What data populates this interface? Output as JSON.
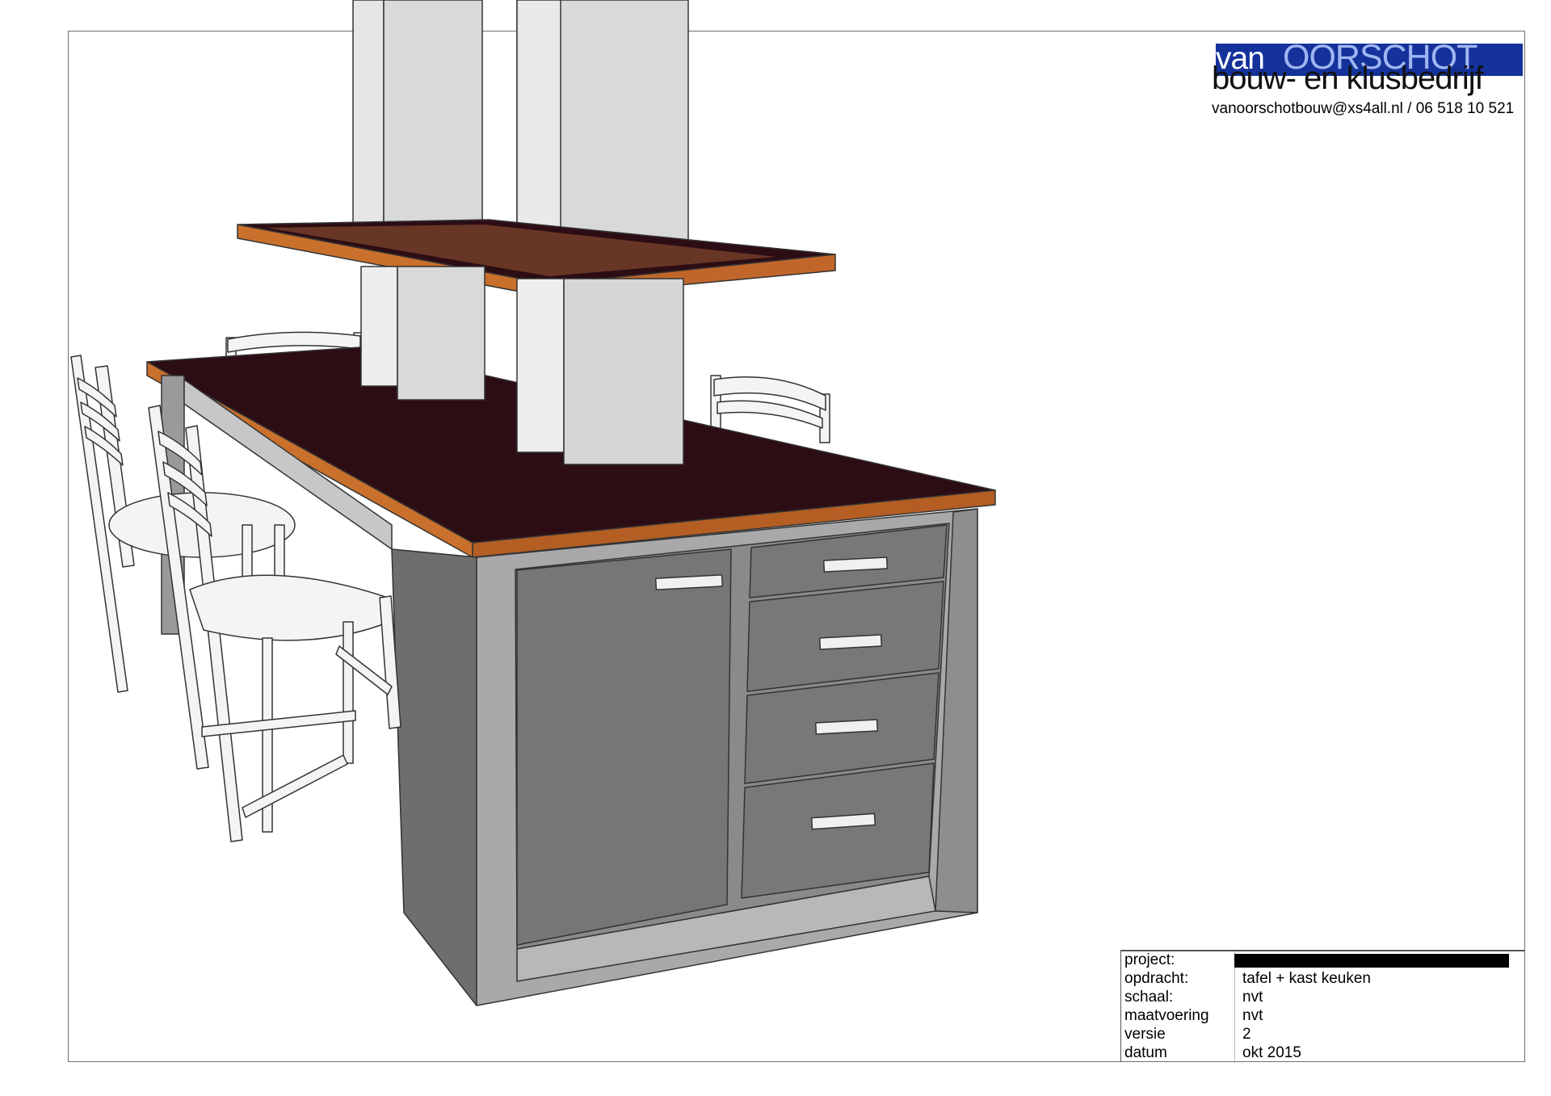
{
  "logo": {
    "brand_small": "van",
    "brand_large": "OORSCHOT",
    "subtitle": "bouw- en klusbedrijf",
    "contact": "vanoorschotbouw@xs4all.nl / 06 518 10 521",
    "brand_color": "#14329a"
  },
  "title_block": {
    "rows": [
      {
        "label": "project:",
        "value": ""
      },
      {
        "label": "opdracht:",
        "value": "tafel + kast keuken"
      },
      {
        "label": "schaal:",
        "value": "nvt"
      },
      {
        "label": "maatvoering",
        "value": "nvt"
      },
      {
        "label": "versie",
        "value": "2"
      },
      {
        "label": "datum",
        "value": "okt 2015"
      }
    ]
  },
  "colors": {
    "countertop": "#2d0d14",
    "wood_edge": "#c8702c",
    "cabinet": "#7a7a7c",
    "cabinet_frame": "#a9a9ab",
    "column": "#e6e6e6",
    "chair": "#f4f4f4"
  }
}
